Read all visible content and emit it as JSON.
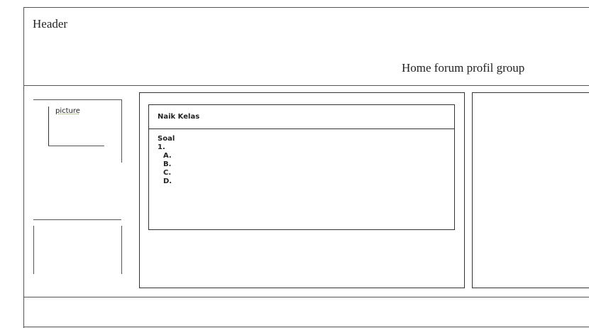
{
  "header": {
    "title": "Header",
    "nav": "Home forum profil group"
  },
  "sidebar": {
    "picture_label": "picture"
  },
  "main": {
    "title": "Naik Kelas",
    "section": "Soal",
    "question_number": "1.",
    "options": [
      "A.",
      "B.",
      "C.",
      "D."
    ]
  }
}
